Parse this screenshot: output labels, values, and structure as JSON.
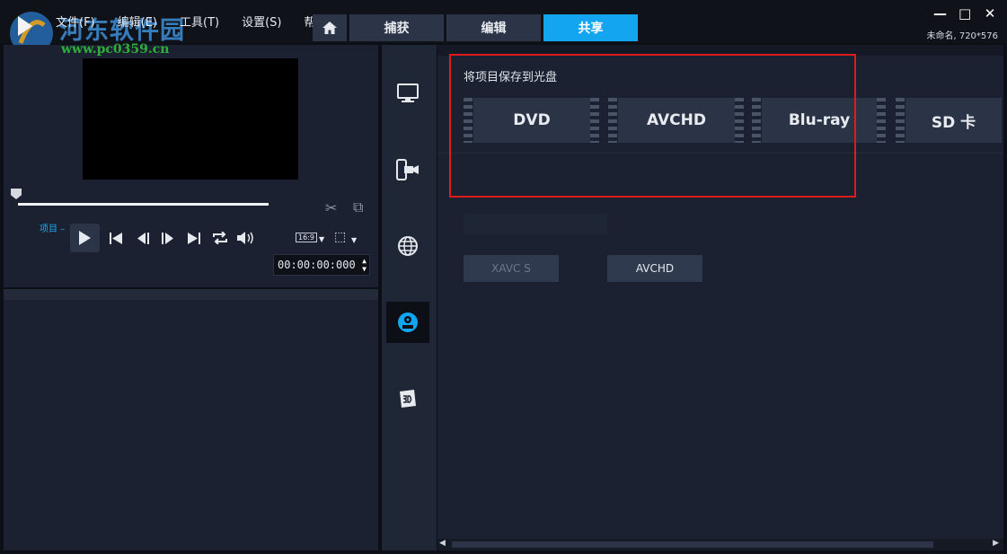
{
  "watermark": {
    "site_name": "河东软件园",
    "url": "www.pc0359.cn"
  },
  "menu": {
    "items": [
      "文件(F)",
      "编辑(E)",
      "工具(T)",
      "设置(S)",
      "帮助"
    ]
  },
  "tabs": {
    "capture": "捕获",
    "edit": "编辑",
    "share": "共享",
    "active": "share"
  },
  "window": {
    "project_info": "未命名, 720*576",
    "icons": [
      "minimize-icon",
      "maximize-icon",
      "close-icon"
    ]
  },
  "player": {
    "project_label": "项目",
    "aspect_ratio": "16:9",
    "timecode": "00:00:00:000",
    "controls": [
      "play-icon",
      "skip-to-start-icon",
      "prev-frame-icon",
      "next-frame-icon",
      "skip-to-end-icon",
      "repeat-icon",
      "volume-icon"
    ]
  },
  "share_sidebar": {
    "items": [
      "computer-output-icon",
      "device-output-icon",
      "web-upload-icon",
      "disc-output-icon",
      "3d-output-icon"
    ],
    "active": "disc-output-icon"
  },
  "content": {
    "save_title": "将项目保存到光盘",
    "disc_options": [
      "DVD",
      "AVCHD",
      "Blu-ray",
      "SD 卡"
    ],
    "format_buttons": [
      {
        "label": "XAVC S",
        "enabled": false
      },
      {
        "label": "AVCHD",
        "enabled": true
      }
    ]
  },
  "colors": {
    "accent": "#13a5ef",
    "panel": "#1b2130",
    "highlight": "#e01b1b"
  }
}
